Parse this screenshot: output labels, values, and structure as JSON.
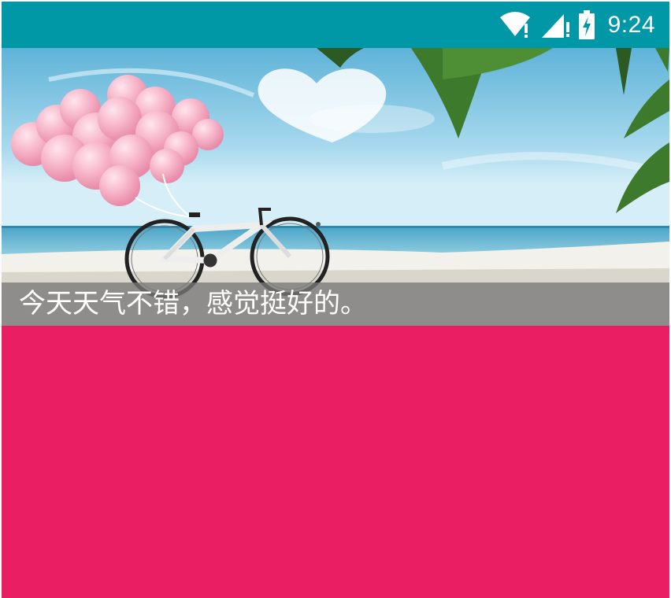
{
  "status_bar": {
    "time": "9:24",
    "icons": [
      "wifi-alert-icon",
      "signal-alert-icon",
      "battery-charging-icon"
    ],
    "color": "#0097a7"
  },
  "banner": {
    "image": "beach-bicycle-balloons",
    "caption": "今天天气不错，感觉挺好的。"
  },
  "content": {
    "background": "#e91e63"
  }
}
